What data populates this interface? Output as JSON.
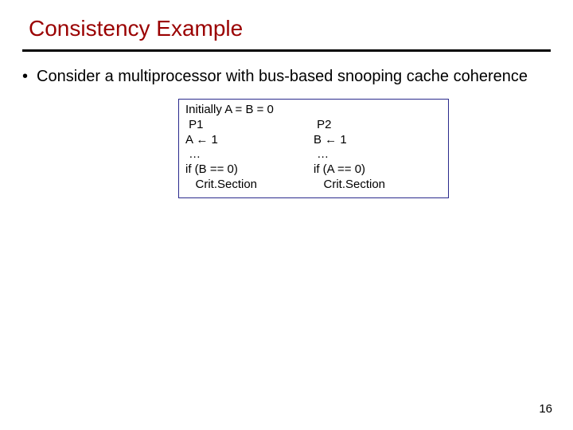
{
  "title": "Consistency Example",
  "bullet": {
    "mark": "•",
    "text": "Consider a multiprocessor with bus-based snooping cache coherence"
  },
  "codebox": {
    "init": "Initially A = B = 0",
    "p1": {
      "name": " P1",
      "assign": "A ← 1",
      "dots": " …",
      "cond": "if (B == 0)",
      "crit": "   Crit.Section"
    },
    "p2": {
      "name": " P2",
      "assign": "B ← 1",
      "dots": " …",
      "cond": "if (A == 0)",
      "crit": "   Crit.Section"
    }
  },
  "page_number": "16"
}
